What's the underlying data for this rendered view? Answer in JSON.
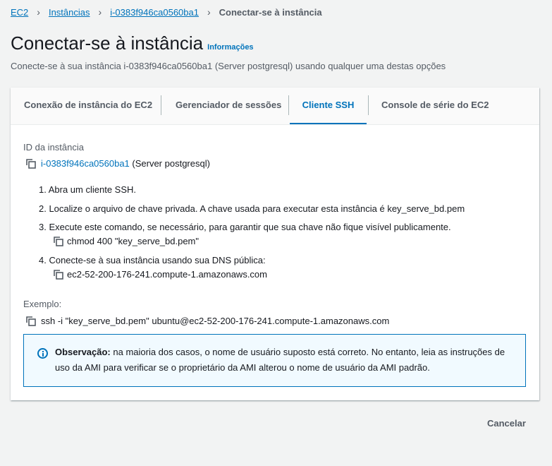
{
  "breadcrumb": {
    "items": [
      "EC2",
      "Instâncias",
      "i-0383f946ca0560ba1"
    ],
    "current": "Conectar-se à instância"
  },
  "header": {
    "title": "Conectar-se à instância",
    "info_link": "Informações",
    "subtitle": "Conecte-se à sua instância i-0383f946ca0560ba1 (Server postgresql) usando qualquer uma destas opções"
  },
  "tabs": [
    {
      "label": "Conexão de instância do EC2",
      "active": false
    },
    {
      "label": "Gerenciador de sessões",
      "active": false
    },
    {
      "label": "Cliente SSH",
      "active": true
    },
    {
      "label": "Console de série do EC2",
      "active": false
    }
  ],
  "ssh": {
    "instance_id_label": "ID da instância",
    "instance_id": "i-0383f946ca0560ba1",
    "instance_name": " (Server postgresql)",
    "steps": [
      "1. Abra um cliente SSH.",
      "2. Localize o arquivo de chave privada. A chave usada para executar esta instância é key_serve_bd.pem",
      "3. Execute este comando, se necessário, para garantir que sua chave não fique visível publicamente.",
      "4. Conecte-se à sua instância usando sua DNS pública:"
    ],
    "chmod_command": "chmod 400 \"key_serve_bd.pem\"",
    "public_dns": "ec2-52-200-176-241.compute-1.amazonaws.com",
    "example_label": "Exemplo:",
    "example_command": "ssh -i \"key_serve_bd.pem\" ubuntu@ec2-52-200-176-241.compute-1.amazonaws.com"
  },
  "alert": {
    "bold": "Observação:",
    "text": " na maioria dos casos, o nome de usuário suposto está correto. No entanto, leia as instruções de uso da AMI para verificar se o proprietário da AMI alterou o nome de usuário da AMI padrão."
  },
  "footer": {
    "cancel_label": "Cancelar"
  },
  "colors": {
    "accent": "#0073bb",
    "background": "#f2f3f3",
    "text": "#16191f",
    "muted": "#545b64"
  },
  "icons": [
    "chevron-right-icon",
    "copy-icon",
    "info-icon"
  ]
}
